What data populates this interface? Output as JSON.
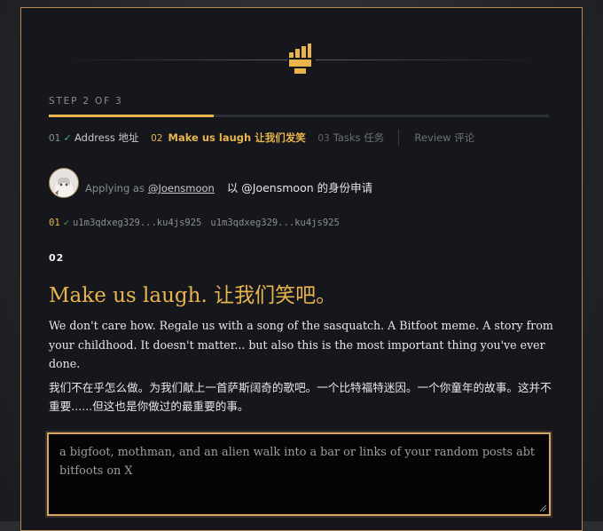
{
  "wizard": {
    "step_label": "STEP 2 OF 3",
    "progress": 0.33,
    "steps": [
      {
        "num": "01",
        "check": "✓",
        "label": "Address 地址",
        "state": "done"
      },
      {
        "num": "02",
        "label": "Make us laugh 让我们发笑",
        "state": "active"
      },
      {
        "num": "03",
        "label": "Tasks 任务",
        "state": "todo"
      },
      {
        "num": "",
        "label": "Review 评论",
        "state": "todo"
      }
    ]
  },
  "applicant": {
    "prefix": "Applying as",
    "handle": "@Joensmoon",
    "zh_text": "以 @Joensmoon 的身份申请"
  },
  "wallet": {
    "num": "01",
    "check": "✓",
    "address": "u1m3qdxeg329...ku4js925",
    "address_dup": "u1m3qdxeg329...ku4js925"
  },
  "section": {
    "number": "02",
    "title": "Make us laugh.  让我们笑吧。",
    "description_en": "We don't care how. Regale us with a song of the sasquatch. A Bitfoot meme. A story from your childhood. It doesn't matter... but also this is the most important thing you've ever done.",
    "description_zh": "我们不在乎怎么做。为我们献上一首萨斯阔奇的歌吧。一个比特福特迷因。一个你童年的故事。这并不重要......但这也是你做过的最重要的事。"
  },
  "input": {
    "placeholder": "a bigfoot, mothman, and an alien walk into a bar or links of your random posts abt bitfoots on X",
    "value": ""
  },
  "colors": {
    "accent": "#e9b44c",
    "check": "#3fae68",
    "panel_bg": "#15171d",
    "border": "#b08a4c"
  },
  "icons": {
    "logo": "bitfoot-logo-icon",
    "check": "check-icon",
    "grip": "resize-grip-icon"
  }
}
